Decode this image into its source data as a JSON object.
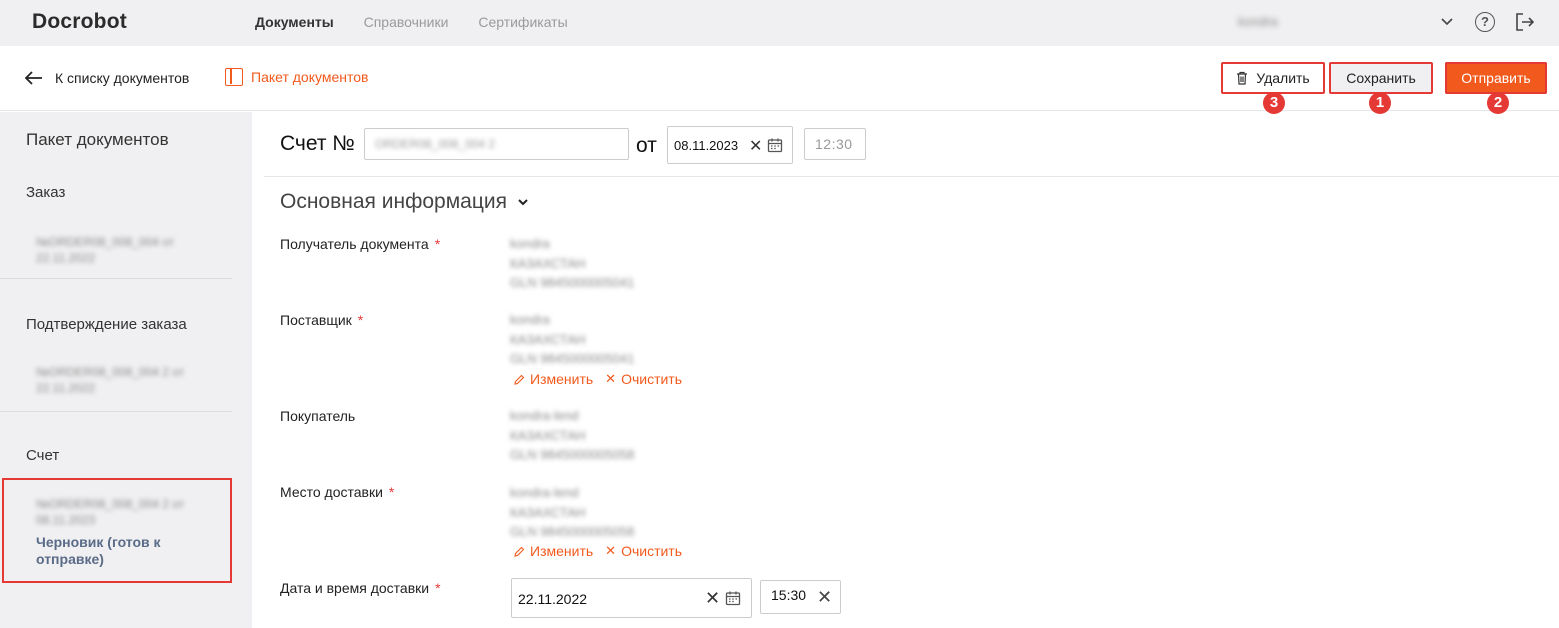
{
  "app": {
    "logo": "Docrobot",
    "nav": [
      "Документы",
      "Справочники",
      "Сертификаты"
    ],
    "user": "kondra"
  },
  "subbar": {
    "back_label": "К списку документов",
    "package_label": "Пакет документов",
    "delete_label": "Удалить",
    "save_label": "Сохранить",
    "send_label": "Отправить",
    "badges": [
      "3",
      "1",
      "2"
    ]
  },
  "sidebar": {
    "title": "Пакет документов",
    "sections": [
      {
        "label": "Заказ",
        "doc": "№ORDER08_008_004 от 22.11.2022"
      },
      {
        "label": "Подтверждение заказа",
        "doc": "№ORDER08_008_004 2 от 22.11.2022"
      },
      {
        "label": "Счет",
        "doc": "№ORDER08_008_004 2 от 08.11.2023",
        "status": "Черновик (готов к отправке)"
      }
    ]
  },
  "main": {
    "invoice_title": "Счет №",
    "invoice_number": "ORDER08_008_004 2",
    "from_label": "от",
    "invoice_date": "08.11.2023",
    "invoice_time": "12:30",
    "section_title": "Основная информация",
    "fields": {
      "recipient": {
        "label": "Получатель документа",
        "required": "*",
        "name": "kondra",
        "country": "КАЗАХСТАН",
        "gln": "GLN  9845000005041"
      },
      "supplier": {
        "label": "Поставщик",
        "required": "*",
        "name": "kondra",
        "country": "КАЗАХСТАН",
        "gln": "GLN  9845000005041"
      },
      "buyer": {
        "label": "Покупатель",
        "name": "kondra-lend",
        "country": "КАЗАХСТАН",
        "gln": "GLN  9845000005058"
      },
      "delivery_place": {
        "label": "Место доставки",
        "required": "*",
        "name": "kondra-lend",
        "country": "КАЗАХСТАН",
        "gln": "GLN  9845000005058"
      },
      "delivery_datetime": {
        "label": "Дата и время доставки",
        "required": "*",
        "date": "22.11.2022",
        "time": "15:30"
      }
    },
    "edit_label": "Изменить",
    "clear_label": "Очистить"
  },
  "colors": {
    "accent": "#f25a1d",
    "highlight": "#e53935",
    "sidebar_bg": "#f0f0f2",
    "status": "#5a6b88"
  }
}
